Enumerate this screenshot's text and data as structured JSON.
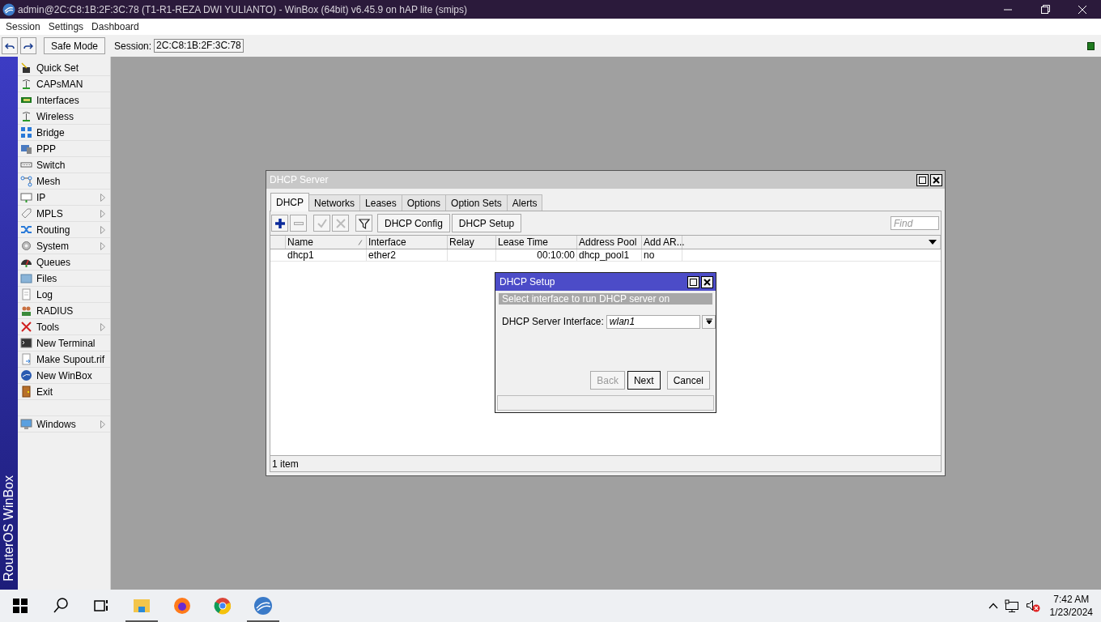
{
  "window": {
    "title": "admin@2C:C8:1B:2F:3C:78 (T1-R1-REZA DWI YULIANTO) - WinBox (64bit) v6.45.9 on hAP lite (smips)"
  },
  "menu_bar": [
    "Session",
    "Settings",
    "Dashboard"
  ],
  "toolbar": {
    "safe_mode": "Safe Mode",
    "session_label": "Session:",
    "session_value": "2C:C8:1B:2F:3C:78",
    "connected": true
  },
  "sidebar": {
    "brand": "RouterOS WinBox",
    "items": [
      {
        "label": "Quick Set",
        "has_submenu": false
      },
      {
        "label": "CAPsMAN",
        "has_submenu": false
      },
      {
        "label": "Interfaces",
        "has_submenu": false
      },
      {
        "label": "Wireless",
        "has_submenu": false
      },
      {
        "label": "Bridge",
        "has_submenu": false
      },
      {
        "label": "PPP",
        "has_submenu": false
      },
      {
        "label": "Switch",
        "has_submenu": false
      },
      {
        "label": "Mesh",
        "has_submenu": false
      },
      {
        "label": "IP",
        "has_submenu": true
      },
      {
        "label": "MPLS",
        "has_submenu": true
      },
      {
        "label": "Routing",
        "has_submenu": true
      },
      {
        "label": "System",
        "has_submenu": true
      },
      {
        "label": "Queues",
        "has_submenu": false
      },
      {
        "label": "Files",
        "has_submenu": false
      },
      {
        "label": "Log",
        "has_submenu": false
      },
      {
        "label": "RADIUS",
        "has_submenu": false
      },
      {
        "label": "Tools",
        "has_submenu": true
      },
      {
        "label": "New Terminal",
        "has_submenu": false
      },
      {
        "label": "Make Supout.rif",
        "has_submenu": false
      },
      {
        "label": "New WinBox",
        "has_submenu": false
      },
      {
        "label": "Exit",
        "has_submenu": false
      }
    ],
    "bottom_items": [
      {
        "label": "Windows",
        "has_submenu": true
      }
    ]
  },
  "dhcp_server": {
    "title": "DHCP Server",
    "tabs": [
      {
        "label": "DHCP",
        "selected": true
      },
      {
        "label": "Networks",
        "selected": false
      },
      {
        "label": "Leases",
        "selected": false
      },
      {
        "label": "Options",
        "selected": false
      },
      {
        "label": "Option Sets",
        "selected": false
      },
      {
        "label": "Alerts",
        "selected": false
      }
    ],
    "icon_buttons": [
      {
        "kind": "add",
        "disabled": false
      },
      {
        "kind": "remove",
        "disabled": true
      },
      {
        "kind": "enable",
        "disabled": true
      },
      {
        "kind": "disable",
        "disabled": true
      },
      {
        "kind": "filter",
        "disabled": false
      }
    ],
    "buttons": [
      "DHCP Config",
      "DHCP Setup"
    ],
    "search": {
      "placeholder": "Find"
    },
    "table": {
      "columns": [
        {
          "label": "Name",
          "sorted": true
        },
        {
          "label": "Interface",
          "sorted": false
        },
        {
          "label": "Relay",
          "sorted": false
        },
        {
          "label": "Lease Time",
          "sorted": false
        },
        {
          "label": "Address Pool",
          "sorted": false
        },
        {
          "label": "Add AR...",
          "sorted": false
        }
      ],
      "rows": [
        [
          "dhcp1",
          "ether2",
          "",
          "00:10:00",
          "dhcp_pool1",
          "no"
        ]
      ]
    },
    "status": "1 item"
  },
  "dhcp_setup": {
    "title": "DHCP Setup",
    "banner": "Select interface to run DHCP server on",
    "field_label": "DHCP Server Interface:",
    "field_value": "wlan1",
    "buttons": [
      {
        "label": "Back",
        "disabled": true,
        "default": false
      },
      {
        "label": "Next",
        "disabled": false,
        "default": true
      },
      {
        "label": "Cancel",
        "disabled": false,
        "default": false
      }
    ]
  },
  "taskbar": {
    "time": "7:42 AM",
    "date": "1/23/2024"
  }
}
